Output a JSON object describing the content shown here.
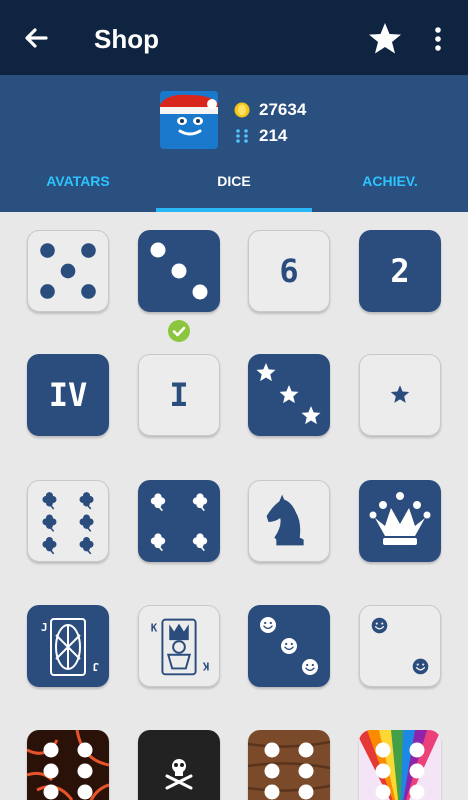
{
  "toolbar": {
    "title": "Shop",
    "back_icon": "arrow-left-icon",
    "favorite_icon": "star-icon",
    "menu_icon": "more-vertical-icon"
  },
  "profile": {
    "coins": "27634",
    "dice_count": "214",
    "coin_icon": "coin-icon",
    "dice_icon": "dice-icon"
  },
  "tabs": [
    {
      "label": "AVATARS",
      "active": false
    },
    {
      "label": "DICE",
      "active": true
    },
    {
      "label": "ACHIEV.",
      "active": false
    }
  ],
  "colors": {
    "toolbar": "#0f2440",
    "header": "#2a5080",
    "tab_inactive": "#2cc4ff",
    "tab_indicator": "#29b6f6",
    "die_dark": "#2b4d7e",
    "die_light": "#ececec",
    "selected_check": "#8cc63f"
  },
  "dice": [
    {
      "style": "light",
      "face": "pips-5"
    },
    {
      "style": "dark",
      "face": "pips-3",
      "selected": true
    },
    {
      "style": "light",
      "face": "number",
      "label": "6"
    },
    {
      "style": "dark",
      "face": "number",
      "label": "2"
    },
    {
      "style": "dark",
      "face": "roman",
      "label": "IV"
    },
    {
      "style": "light",
      "face": "roman",
      "label": "I"
    },
    {
      "style": "dark",
      "face": "stars-3"
    },
    {
      "style": "light",
      "face": "star-1"
    },
    {
      "style": "light",
      "face": "clovers-6"
    },
    {
      "style": "dark",
      "face": "clovers-4"
    },
    {
      "style": "light",
      "face": "chess-knight"
    },
    {
      "style": "dark",
      "face": "chess-queen"
    },
    {
      "style": "dark",
      "face": "card-jack"
    },
    {
      "style": "light",
      "face": "card-king"
    },
    {
      "style": "dark",
      "face": "smileys-3"
    },
    {
      "style": "light",
      "face": "smileys-2"
    },
    {
      "style": "lava",
      "face": "pips-6"
    },
    {
      "style": "black",
      "face": "skull"
    },
    {
      "style": "wood",
      "face": "pips-6"
    },
    {
      "style": "rainbow",
      "face": "pips-6"
    }
  ]
}
